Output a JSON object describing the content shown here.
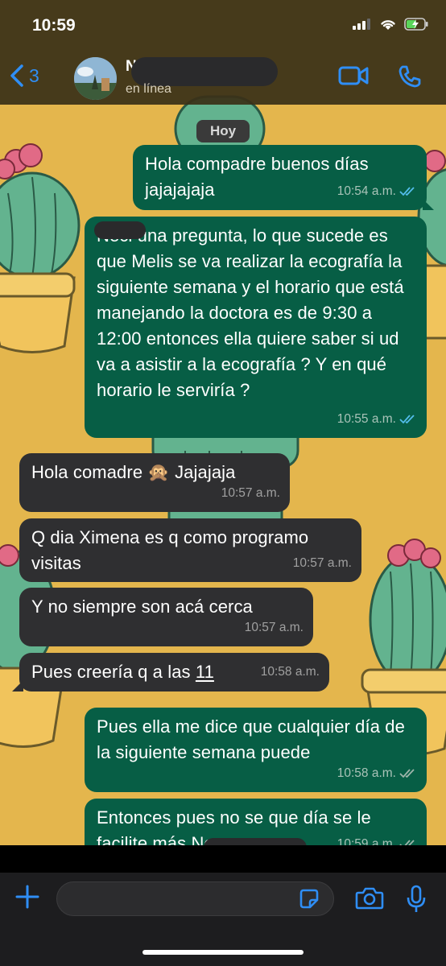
{
  "status": {
    "time": "10:59"
  },
  "header": {
    "back_count": "3",
    "contact_name": "N",
    "contact_status": "en línea"
  },
  "chat": {
    "date_chip": "Hoy",
    "messages": [
      {
        "dir": "out",
        "text": "Hola compadre buenos días jajajajaja",
        "time": "10:54 a.m.",
        "status": "read"
      },
      {
        "dir": "out",
        "text": "Neci una pregunta, lo que sucede es que Melis se va realizar la ecografía la siguiente semana y el horario que está manejando la doctora es de 9:30 a 12:00 entonces ella quiere saber si ud va a asistir a la ecografía ? Y en qué horario le serviría ?",
        "time": "10:55 a.m.",
        "status": "read"
      },
      {
        "dir": "in",
        "text": "Hola comadre 🙊 Jajajaja",
        "time": "10:57 a.m."
      },
      {
        "dir": "in",
        "text": "Q dia Ximena es q como programo visitas",
        "time": "10:57 a.m."
      },
      {
        "dir": "in",
        "text": "Y no siempre son acá cerca",
        "time": "10:57 a.m."
      },
      {
        "dir": "in",
        "text": "Pues creería q a las ",
        "text_link": "11",
        "time": "10:58 a.m."
      },
      {
        "dir": "out",
        "text": "Pues ella me dice que cualquier día de la siguiente semana puede",
        "time": "10:58 a.m.",
        "status": "delivered"
      },
      {
        "dir": "out",
        "text": "Entonces pues no se que día se le facilite más Ne",
        "time": "10:59 a.m.",
        "status": "delivered"
      }
    ]
  },
  "colors": {
    "outgoing_bubble": "#075e45",
    "incoming_bubble": "#2f2f31",
    "accent": "#2f8ef5",
    "read_tick": "#53bdeb",
    "wallpaper": "#e4b64d"
  },
  "icons": {
    "back": "chevron-left-icon",
    "video": "video-camera-icon",
    "call": "phone-icon",
    "attach": "plus-icon",
    "sticker": "sticker-icon",
    "camera": "camera-icon",
    "mic": "microphone-icon"
  }
}
